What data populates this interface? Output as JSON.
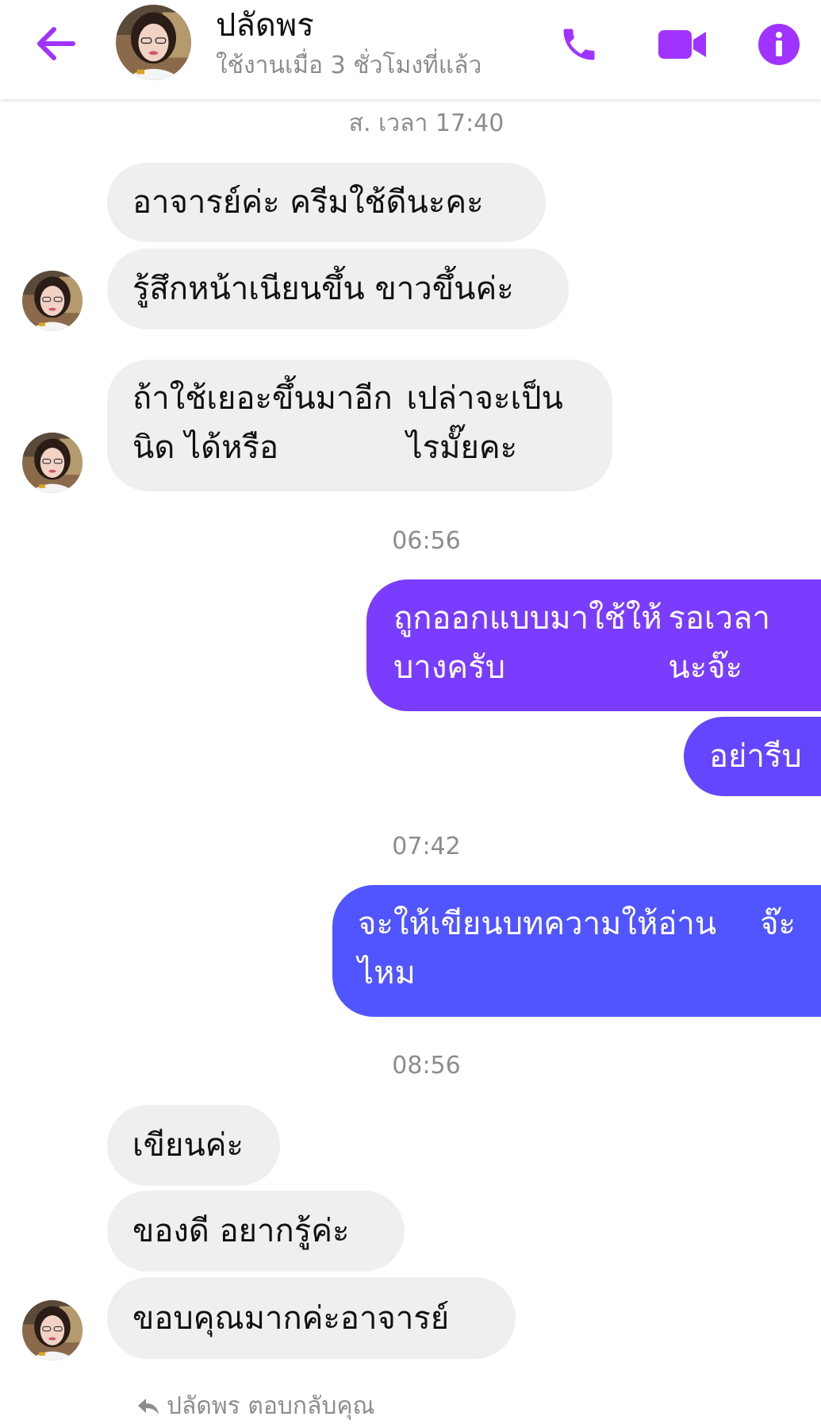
{
  "header": {
    "contact_name": "ปลัดพร",
    "status": "ใช้งานเมื่อ 3 ชั่วโมงที่แล้ว",
    "icons": {
      "back": "arrow-left-icon",
      "call": "phone-icon",
      "video": "video-camera-icon",
      "info": "info-icon"
    }
  },
  "colors": {
    "accent": "#a033ff",
    "incoming_bubble": "#efefef",
    "outgoing_top": "#7a3cff",
    "outgoing_bottom": "#5055ff",
    "muted_text": "#8a8d91"
  },
  "messages": {
    "ts1": "ส. เวลา 17:40",
    "m1": "อาจารย์ค่ะ  ครีมใช้ดีนะคะ",
    "m2": "รู้สึกหน้าเนียนขึ้น ขาวขึ้นค่ะ",
    "m3_line1": "ถ้าใช้เยอะขึ้นมาอีกนิด  ได้หรือ",
    "m3_line2": "เปล่าจะเป็นไรมั๊ยคะ",
    "ts2": "06:56",
    "m4_line1": "ถูกออกแบบมาใช้ให้บางครับ",
    "m4_line2": "รอเวลานะจ๊ะ",
    "m5": "อย่ารีบ",
    "ts3": "07:42",
    "m6_line1": "จะให้เขียนบทความให้อ่านไหม",
    "m6_line2": "จ๊ะ",
    "ts4": "08:56",
    "m7": "เขียนค่ะ",
    "m8": "ของดี  อยากรู้ค่ะ",
    "m9": "ขอบคุณมากค่ะอาจารย์"
  },
  "footer": {
    "reply_note": "ปลัดพร ตอบกลับคุณ",
    "reply_icon": "reply-arrow-icon"
  }
}
